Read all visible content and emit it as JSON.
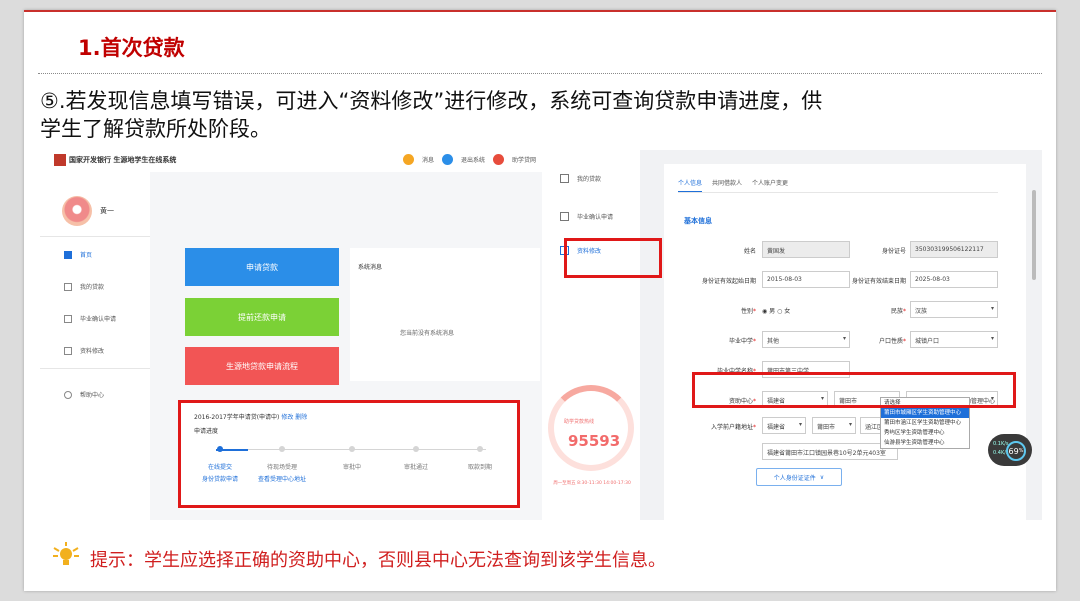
{
  "slide": {
    "title": "1.首次贷款",
    "paragraph_line1": "⑤.若发现信息填写错误，可进入“资料修改”进行修改，系统可查询贷款申请进度，供",
    "paragraph_line2": "学生了解贷款所处阶段。",
    "tip": "提示：学生应选择正确的资助中心，否则县中心无法查询到该学生信息。",
    "tip_icon": "lightbulb-icon"
  },
  "left_screenshot": {
    "logo_text": "国家开发银行 生源地学生在线系统",
    "header_links": [
      "消息",
      "退出系统",
      "助学贷网"
    ],
    "user_name": "黄一",
    "menu": [
      "首页",
      "我的贷款",
      "毕业确认申请",
      "资料修改",
      "帮助中心"
    ],
    "buttons": [
      "申请贷款",
      "提前还款申请",
      "生源地贷款申请流程"
    ],
    "system_message_title": "系统消息",
    "system_message_empty": "您当前没有系统消息",
    "progress": {
      "header": "2016-2017学年申请贷(申请中)",
      "links": [
        "修改",
        "删除"
      ],
      "subheader": "申请进度",
      "steps": [
        "在线提交",
        "待现场受理",
        "审批中",
        "审批通过",
        "取款到期"
      ],
      "step_subs": [
        "身份贷款申请",
        "查看受理中心地址"
      ]
    }
  },
  "right_screenshot": {
    "menu": [
      "我的贷款",
      "毕业确认申请",
      "资料修改"
    ],
    "tabs": [
      "个人信息",
      "共同借款人",
      "个人账户变更"
    ],
    "section": "基本信息",
    "fields": {
      "name_label": "姓名",
      "name_value": "黄国发",
      "id_label": "身份证号",
      "id_value": "350303199506122117",
      "id_start_label": "身份证有效起始日期",
      "id_start_value": "2015-08-03",
      "id_end_label": "身份证有效结束日期",
      "id_end_value": "2025-08-03",
      "gender_label": "性别",
      "gender_male": "男",
      "gender_female": "女",
      "ethnic_label": "民族",
      "ethnic_value": "汉族",
      "school_label": "毕业中学",
      "school_value": "其他",
      "hukou_label": "户口性质",
      "hukou_value": "城镇户口",
      "school_name_label": "毕业中学名称",
      "school_name_value": "莆田市第三中学",
      "center_label": "资助中心",
      "center_province": "福建省",
      "center_city": "莆田市",
      "center_value": "莆田市城厢区学生资助管理中心",
      "addr_label": "入学前户籍地址",
      "addr_province": "福建省",
      "addr_city": "莆田市",
      "addr_district": "涵江区",
      "addr_detail": "福建省莆田市江口镇园景巷10号2单元403室"
    },
    "dropdown_options": [
      "请选择",
      "莆田市城厢区学生资助管理中心",
      "莆田市涵江区学生资助管理中心",
      "秀屿区学生资助管理中心",
      "仙游县学生资助管理中心"
    ],
    "more_button": "个人身份证证件",
    "ring": {
      "label": "助学贷款热线",
      "number": "95593",
      "note": "周一至周五 8:30-11:30 14:00-17:30"
    }
  },
  "widget": {
    "value": "69",
    "unit": "%",
    "up": "0.1K/s",
    "down": "0.4K/s"
  }
}
